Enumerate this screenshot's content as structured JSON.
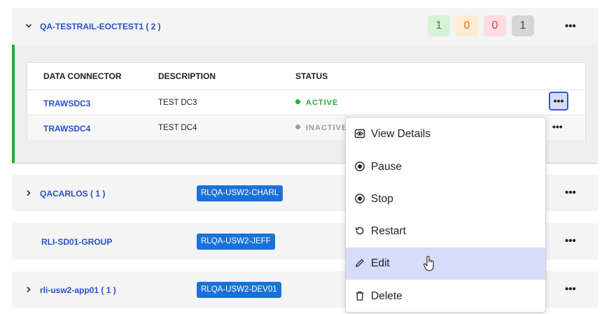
{
  "expanded_group": {
    "name": "QA-TESTRAIL-EOCTEST1 ( 2 )",
    "counts": [
      {
        "value": "1",
        "bg": "#d8f2d8",
        "fg": "#2e8b3c"
      },
      {
        "value": "0",
        "bg": "#fdebd2",
        "fg": "#d9791a"
      },
      {
        "value": "0",
        "bg": "#fbdde1",
        "fg": "#d43a4c"
      },
      {
        "value": "1",
        "bg": "#d5d5d5",
        "fg": "#444444"
      }
    ],
    "more": "•••"
  },
  "table": {
    "headers": [
      "DATA CONNECTOR",
      "DESCRIPTION",
      "STATUS"
    ],
    "rows": [
      {
        "connector": "TRAWSDC3",
        "description": "TEST DC3",
        "status": "ACTIVE",
        "status_color": "#1fae3a",
        "more": "•••"
      },
      {
        "connector": "TRAWSDC4",
        "description": "TEST DC4",
        "status": "INACTIVE",
        "status_color": "#9a9a9a",
        "more": "•••"
      }
    ]
  },
  "groups": [
    {
      "name": "QACARLOS ( 1 )",
      "tag": "RLQA-USW2-CHARL",
      "more": "•••"
    },
    {
      "name": "RLI-SD01-GROUP",
      "tag": "RLQA-USW2-JEFF",
      "more": "•••"
    },
    {
      "name": "rli-usw2-app01 ( 1 )",
      "tag": "RLQA-USW2-DEV01",
      "more": "•••"
    }
  ],
  "menu": {
    "items": [
      {
        "label": "View Details",
        "icon": "eye-icon"
      },
      {
        "label": "Pause",
        "icon": "radio-pause-icon"
      },
      {
        "label": "Stop",
        "icon": "radio-stop-icon"
      },
      {
        "label": "Restart",
        "icon": "restart-icon"
      },
      {
        "label": "Edit",
        "icon": "pencil-icon"
      },
      {
        "label": "Delete",
        "icon": "trash-icon"
      }
    ],
    "highlighted": "Edit"
  },
  "colors": {
    "link": "#2b50c8",
    "accent_green": "#1fae3a",
    "tag_blue": "#1a72d8",
    "menu_highlight": "#d7dcfb"
  }
}
